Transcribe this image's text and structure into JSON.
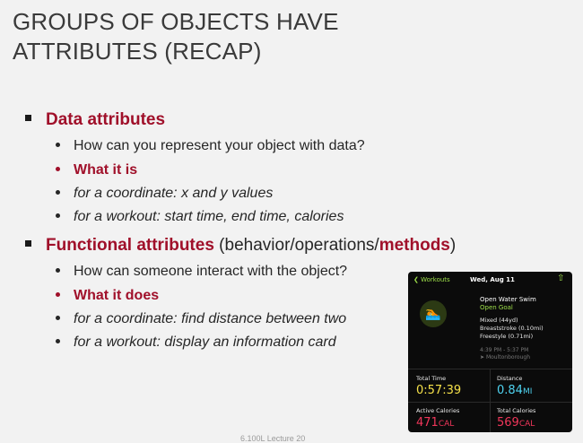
{
  "title": {
    "line1": "GROUPS OF OBJECTS HAVE",
    "line2": "ATTRIBUTES (RECAP)"
  },
  "sections": [
    {
      "heading": "Data attributes",
      "heading_suffix": "",
      "items": [
        "How can you represent your object with data?",
        "What it is",
        "for a coordinate: x and y values",
        "for a workout: start time, end time, calories"
      ]
    },
    {
      "heading": "Functional attributes",
      "heading_mid": " (behavior/operations/",
      "heading_red2": "methods",
      "heading_end": ")",
      "items": [
        "How can someone interact with the object?",
        "What it does",
        "for a coordinate: find distance between two",
        "for a workout: display an information card"
      ]
    }
  ],
  "card": {
    "back_label": "Workouts",
    "date": "Wed, Aug 11",
    "workout_name": "Open Water Swim",
    "goal": "Open Goal",
    "details": [
      "Mixed (44yd)",
      "Breaststroke (0.10mi)",
      "Freestyle (0.71mi)"
    ],
    "time_range": "4:39 PM - 5:37 PM",
    "location": "Moultonborough",
    "stats": {
      "total_time_label": "Total Time",
      "total_time": "0:57:39",
      "distance_label": "Distance",
      "distance": "0.84",
      "distance_unit": "MI",
      "active_cal_label": "Active Calories",
      "active_cal": "471",
      "active_cal_unit": "CAL",
      "total_cal_label": "Total Calories",
      "total_cal": "569",
      "total_cal_unit": "CAL"
    },
    "colors": {
      "green": "#9ee04a",
      "yellow": "#f5e14a",
      "cyan": "#4fd3f0",
      "red": "#f0365a"
    }
  },
  "footer": "6.100L Lecture 20"
}
